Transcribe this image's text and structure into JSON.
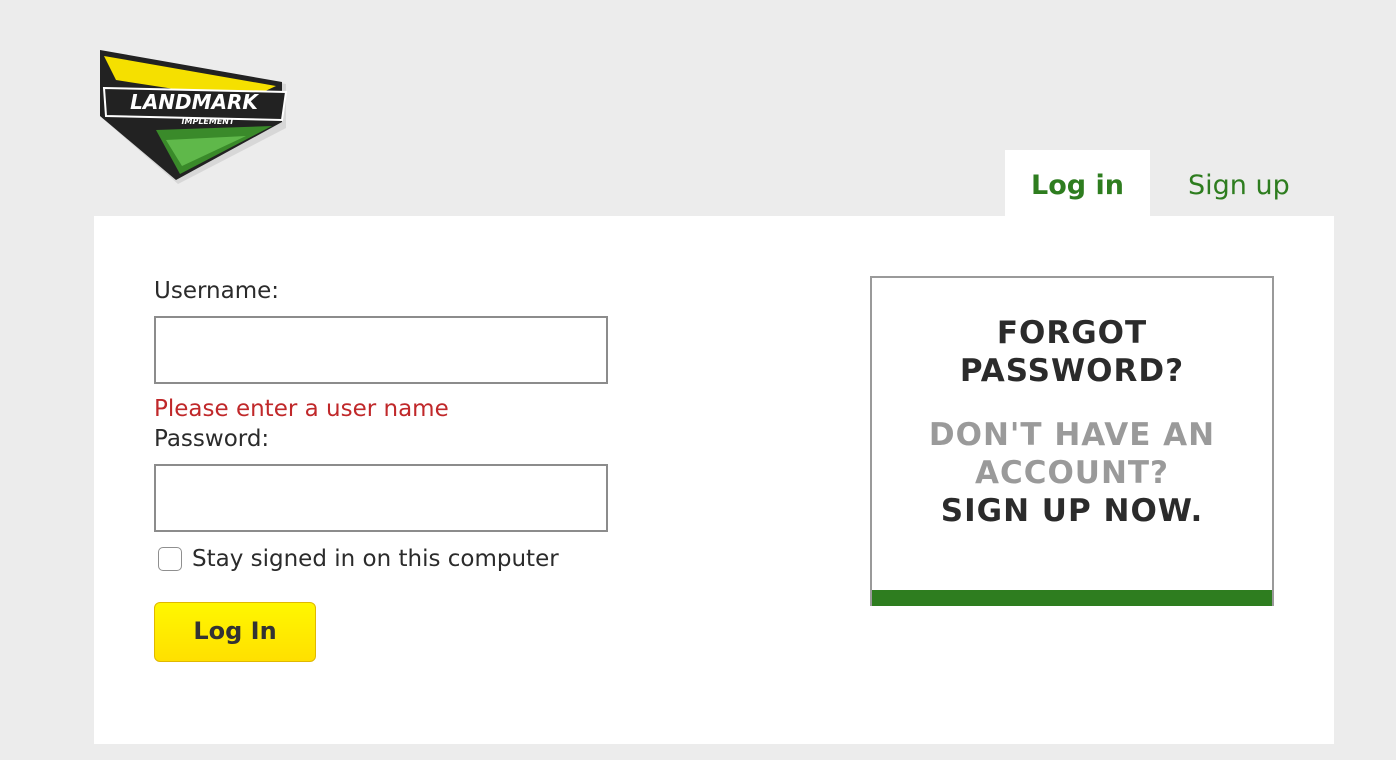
{
  "brand": {
    "logo_text": "LANDMARK",
    "logo_subtext": "IMPLEMENT",
    "colors": {
      "yellow": "#f5e000",
      "green": "#3a8a2a",
      "dark": "#222222"
    }
  },
  "tabs": [
    {
      "label": "Log in",
      "active": true
    },
    {
      "label": "Sign up",
      "active": false
    }
  ],
  "form": {
    "username_label": "Username:",
    "username_value": "",
    "username_error": "Please enter a user name",
    "password_label": "Password:",
    "password_value": "",
    "remember_label": "Stay signed in on this computer",
    "remember_checked": false,
    "submit_label": "Log In"
  },
  "promo": {
    "forgot_password": "FORGOT PASSWORD?",
    "no_account": "DON'T HAVE AN ACCOUNT?",
    "sign_up_now": "SIGN UP NOW."
  },
  "colors": {
    "accent_green": "#2e7d1f",
    "error_red": "#c0282a",
    "button_yellow": "#ffeb00",
    "page_background": "#ececec"
  }
}
